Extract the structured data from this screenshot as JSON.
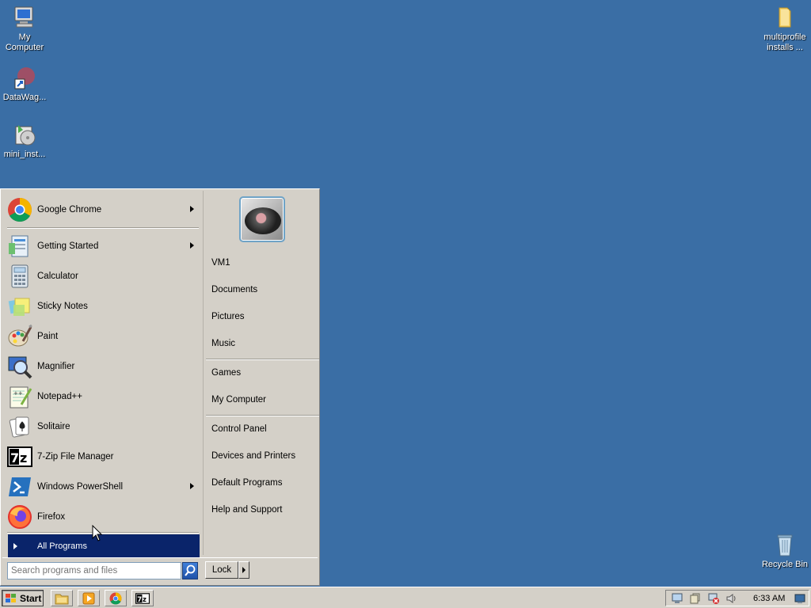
{
  "desktop": {
    "icons": [
      {
        "label": "My Computer"
      },
      {
        "label": "DataWag..."
      },
      {
        "label": "mini_inst..."
      },
      {
        "label": "multiprofile installs ..."
      },
      {
        "label": "Recycle Bin"
      }
    ]
  },
  "start_menu": {
    "pinned": [
      {
        "label": "Google Chrome",
        "has_submenu": true
      }
    ],
    "recent": [
      {
        "label": "Getting Started",
        "has_submenu": true
      },
      {
        "label": "Calculator"
      },
      {
        "label": "Sticky Notes"
      },
      {
        "label": "Paint"
      },
      {
        "label": "Magnifier"
      },
      {
        "label": "Notepad++"
      },
      {
        "label": "Solitaire"
      },
      {
        "label": "7-Zip File Manager"
      },
      {
        "label": "Windows PowerShell",
        "has_submenu": true
      },
      {
        "label": "Firefox"
      }
    ],
    "all_programs_label": "All Programs",
    "search_placeholder": "Search programs and files",
    "right_links": [
      {
        "label": "VM1"
      },
      {
        "label": "Documents"
      },
      {
        "label": "Pictures"
      },
      {
        "label": "Music"
      },
      {
        "label": "Games"
      },
      {
        "label": "My Computer"
      },
      {
        "label": "Control Panel"
      },
      {
        "label": "Devices and Printers"
      },
      {
        "label": "Default Programs"
      },
      {
        "label": "Help and Support"
      }
    ],
    "lock_label": "Lock"
  },
  "taskbar": {
    "start_label": "Start",
    "clock": "6:33 AM"
  },
  "colors": {
    "desktop_bg": "#3a6ea5",
    "menu_bg": "#d4d0c8",
    "highlight": "#0a246a"
  }
}
